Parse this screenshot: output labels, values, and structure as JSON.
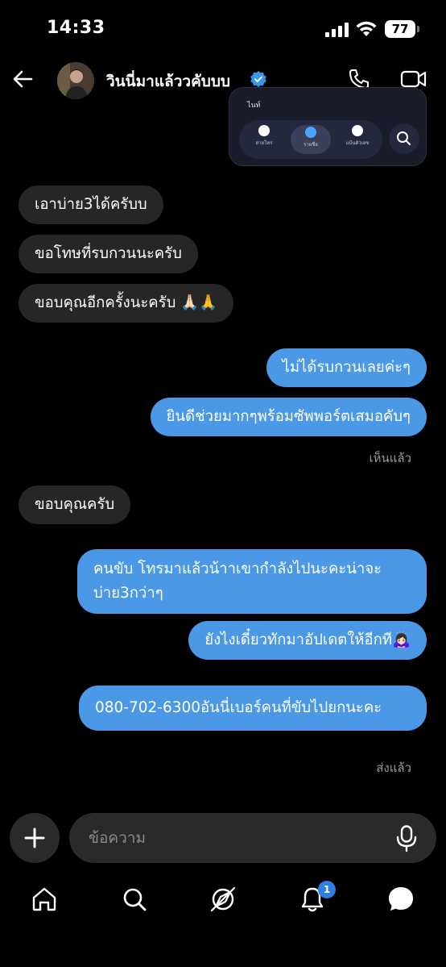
{
  "status": {
    "time": "14:33",
    "battery": "77"
  },
  "header": {
    "contact_name": "วินนี่มาแล้ววคับบบ"
  },
  "shared_image": {
    "top_text": "ไนท์",
    "tabs": [
      "สายโทร",
      "รายชื่อ",
      "แป้นตัวเลข"
    ]
  },
  "messages": [
    {
      "side": "in",
      "text": "เอาบ่าย3ได้ครับบ"
    },
    {
      "side": "in",
      "text": "ขอโทษที่รบกวนนะครับ"
    },
    {
      "side": "in",
      "text": "ขอบคุณอีกครั้งนะครับ 🙏🏻🙏"
    },
    {
      "side": "out",
      "text": "ไม่ได้รบกวนเลยค่ะๆ"
    },
    {
      "side": "out",
      "text": "ยินดีช่วยมากๆพร้อมซัพพอร์ตเสมอคับๆ"
    },
    {
      "side": "in",
      "text": "ขอบคุณครับ"
    },
    {
      "side": "out",
      "text": "คนขับ โทรมาแล้วน้าาเขากำลังไปนะคะน่าจะบ่าย3กว่าๆ"
    },
    {
      "side": "out",
      "text": "ยังไงเดี๋ยวทักมาอัปเดตให้อีกที🙇🏻‍♀️"
    },
    {
      "side": "out",
      "text": "080-702-6300อันนี่เบอร์คนที่ขับไปยกนะคะ"
    }
  ],
  "meta": {
    "seen": "เห็นแล้ว",
    "sent": "ส่งแล้ว"
  },
  "composer": {
    "placeholder": "ข้อความ"
  },
  "nav": {
    "notification_count": "1"
  },
  "colors": {
    "outgoing": "#4a98e6",
    "incoming": "#262626",
    "accent": "#2f7fe0"
  }
}
